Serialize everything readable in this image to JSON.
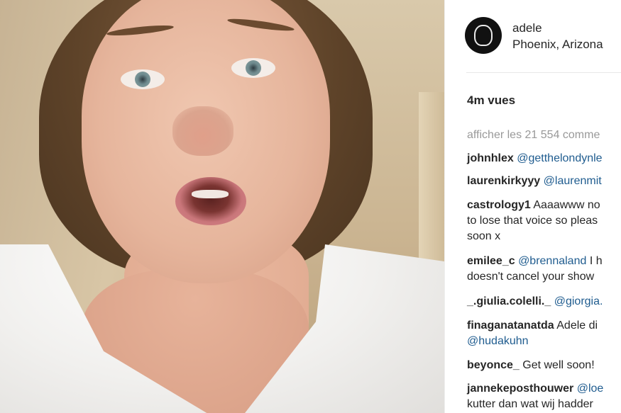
{
  "post": {
    "username": "adele",
    "location": "Phoenix, Arizona",
    "views": "4m vues",
    "more_comments": "afficher les 21 554 comme"
  },
  "comments": [
    {
      "user": "johnhlex",
      "mention": "@getthelondynle",
      "text": "",
      "line2": "",
      "line3": ""
    },
    {
      "user": "laurenkirkyyy",
      "mention": "@laurenmit",
      "text": "",
      "line2": "",
      "line3": ""
    },
    {
      "user": "castrology1",
      "mention": "",
      "text": "Aaaawww no",
      "line2": "to lose that voice so pleas",
      "line3": "soon x"
    },
    {
      "user": "emilee_c",
      "mention": "@brennaland",
      "text": "I h",
      "line2": "doesn't cancel your show",
      "line3": ""
    },
    {
      "user": "_.giulia.colelli._",
      "mention": "@giorgia.",
      "text": "",
      "line2": "",
      "line3": ""
    },
    {
      "user": "finaganatanatda",
      "mention": "",
      "text": "Adele di",
      "line2": "@hudakuhn",
      "line3": ""
    },
    {
      "user": "beyonce_",
      "mention": "",
      "text": "Get well soon!",
      "line2": "",
      "line3": ""
    },
    {
      "user": "jannekeposthouwer",
      "mention": "@loe",
      "text": "",
      "line2": "kutter dan wat wij hadder",
      "line3": ""
    }
  ],
  "colors": {
    "mention": "#1f5c8f",
    "muted": "#999999",
    "text": "#262626"
  }
}
